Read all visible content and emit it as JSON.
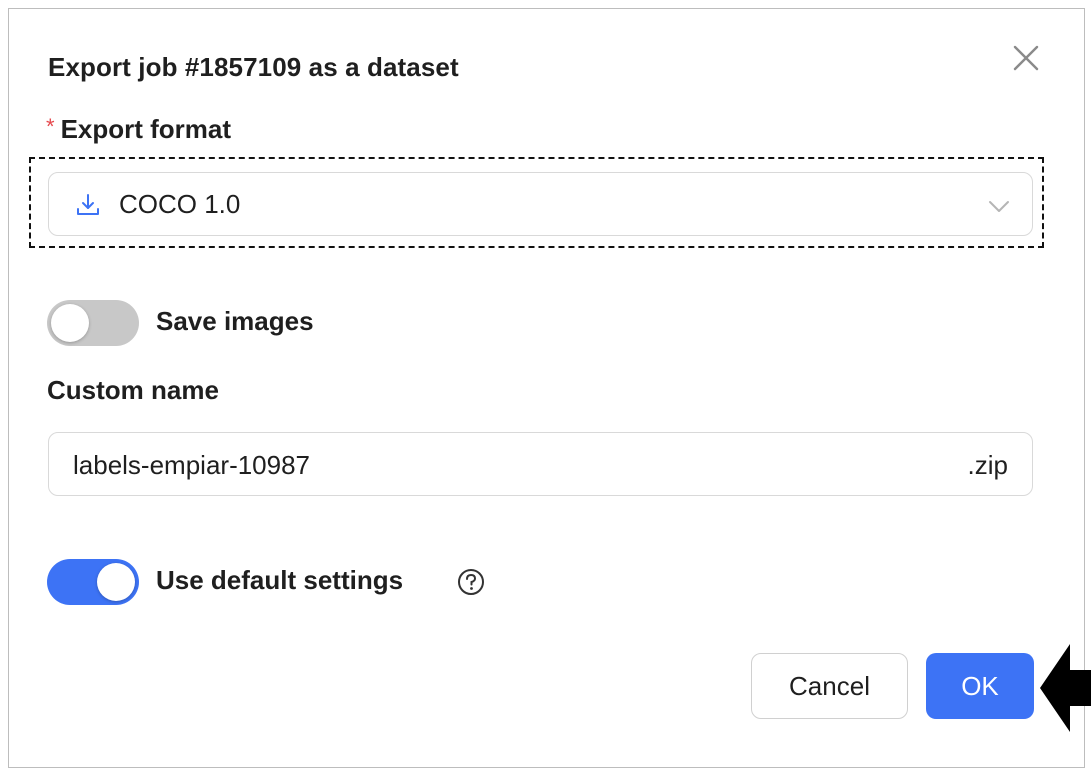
{
  "dialog": {
    "title": "Export job #1857109 as a dataset",
    "close_icon": "close-icon"
  },
  "export_format": {
    "required_mark": "*",
    "label": "Export format",
    "selected_value": "COCO 1.0",
    "value_icon": "download-icon",
    "dropdown_icon": "chevron-down-icon"
  },
  "save_images": {
    "label": "Save images",
    "enabled": false
  },
  "custom_name": {
    "label": "Custom name",
    "value": "labels-empiar-10987",
    "suffix": ".zip"
  },
  "default_settings": {
    "label": "Use default settings",
    "enabled": true,
    "help_icon": "question-circle-icon"
  },
  "footer": {
    "cancel_label": "Cancel",
    "ok_label": "OK"
  },
  "annotation": {
    "pointer_icon": "left-arrow-icon"
  },
  "colors": {
    "accent": "#3d73f5",
    "required": "#e5484d",
    "switch_off": "#c8c8c8",
    "border": "#d9d9d9"
  }
}
